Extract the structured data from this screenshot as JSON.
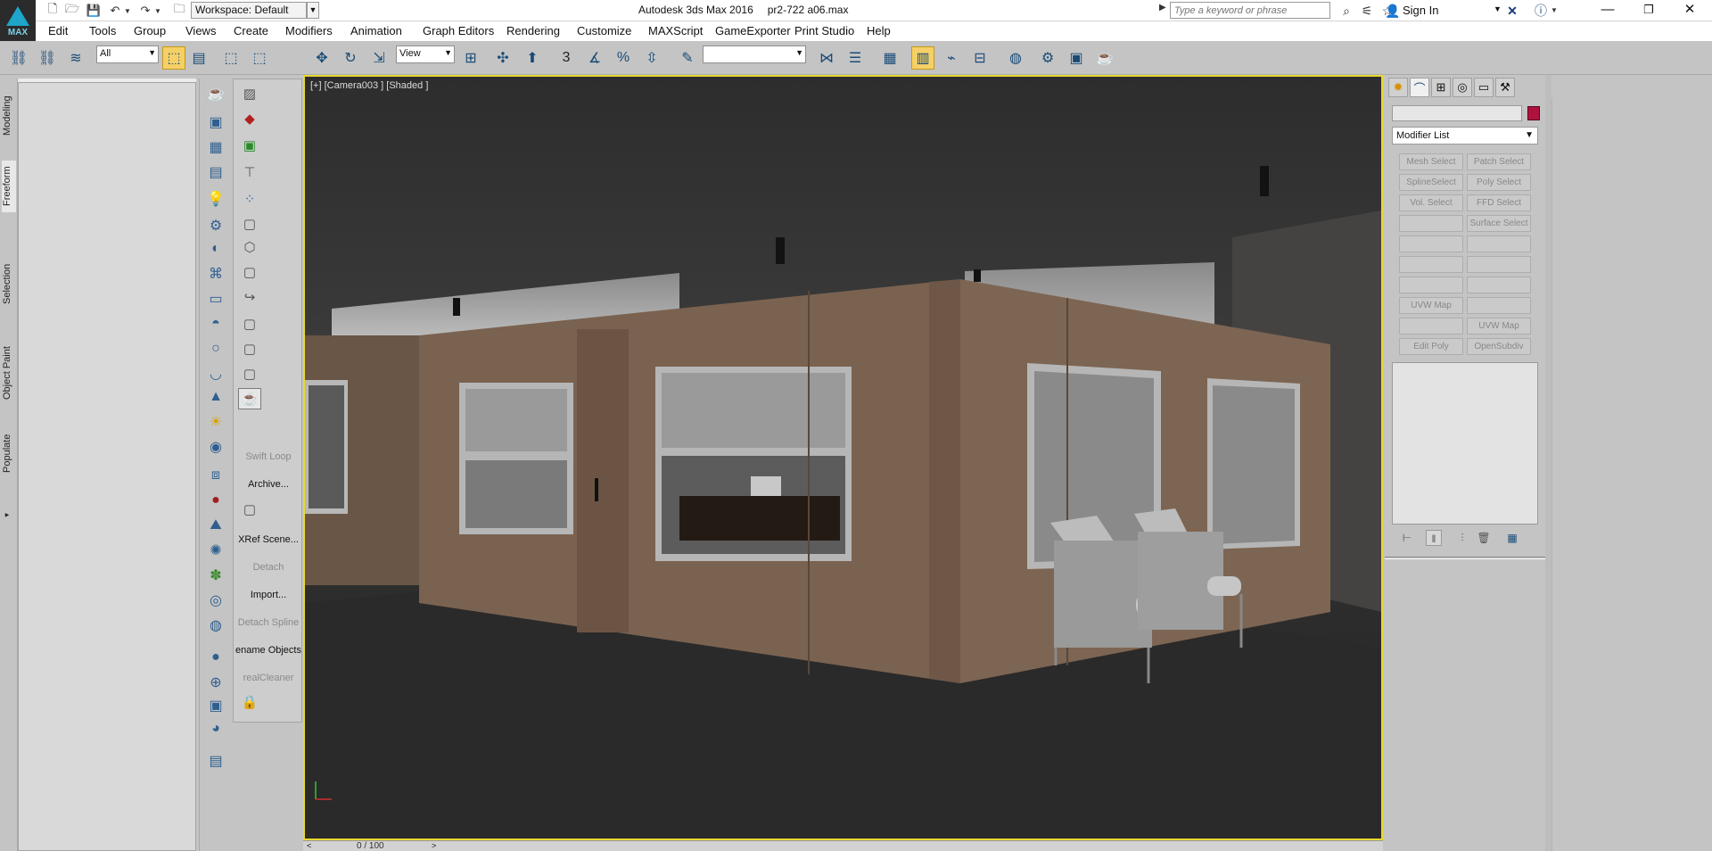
{
  "app": {
    "logo_text": "MAX",
    "workspace": "Workspace: Default",
    "title_app": "Autodesk 3ds Max 2016",
    "title_file": "pr2-722 a06.max",
    "search_placeholder": "Type a keyword or phrase",
    "sign_in": "Sign In"
  },
  "menu": [
    "Edit",
    "Tools",
    "Group",
    "Views",
    "Create",
    "Modifiers",
    "Animation",
    "Graph Editors",
    "Rendering",
    "Customize",
    "MAXScript",
    "GameExporter",
    "Print Studio",
    "Help"
  ],
  "toolbar": {
    "selection_filter": "All",
    "ref_coord": "View",
    "snap_label": "3",
    "named_selection": ""
  },
  "ribbon_tabs": [
    "Modeling",
    "Freeform",
    "Selection",
    "Object Paint",
    "Populate"
  ],
  "command_column": {
    "labels": [
      {
        "text": "Swift Loop",
        "disabled": true
      },
      {
        "text": "Archive...",
        "disabled": false
      },
      {
        "text": "XRef Scene...",
        "disabled": false
      },
      {
        "text": "Detach",
        "disabled": true
      },
      {
        "text": "Import...",
        "disabled": false
      },
      {
        "text": "Detach Spline",
        "disabled": true
      },
      {
        "text": "ename Objects",
        "disabled": false
      },
      {
        "text": "realCleaner",
        "disabled": true
      }
    ]
  },
  "viewport": {
    "label": "[+] [Camera003 ] [Shaded ]"
  },
  "timeline": {
    "frame_text": "0 / 100"
  },
  "command_panel": {
    "modifier_list": "Modifier List",
    "object_color": "#b0123f",
    "buttons": [
      [
        "Mesh Select",
        "Patch Select"
      ],
      [
        "SplineSelect",
        "Poly Select"
      ],
      [
        "Vol. Select",
        "FFD Select"
      ],
      [
        "",
        "Surface Select"
      ],
      [
        "",
        ""
      ],
      [
        "",
        ""
      ],
      [
        "",
        ""
      ],
      [
        "UVW Map",
        ""
      ],
      [
        "",
        "UVW Map"
      ],
      [
        "Edit Poly",
        "OpenSubdiv"
      ]
    ]
  },
  "colors": {
    "viewport_border": "#e8d92f",
    "active_button": "#f5d066",
    "app_blue": "#1ea5c9"
  }
}
